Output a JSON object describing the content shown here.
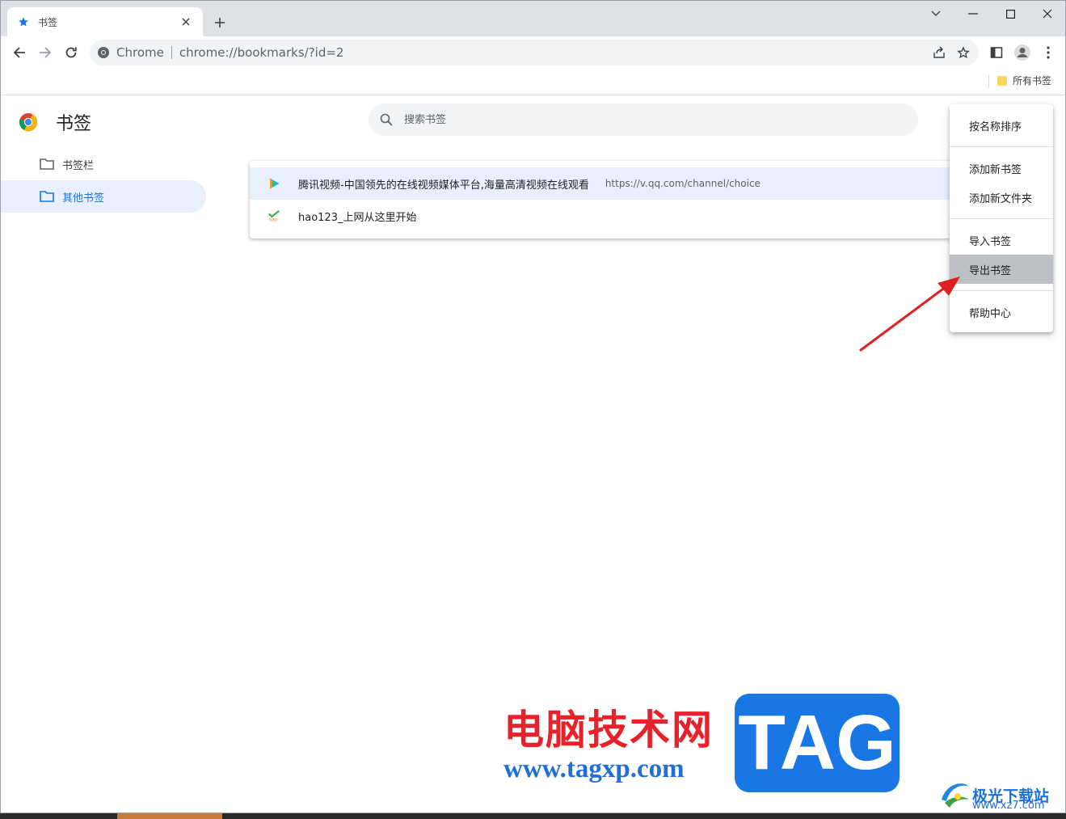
{
  "tab": {
    "title": "书签",
    "close": "×"
  },
  "new_tab": "+",
  "window_controls": {
    "dropdown": "chevron-down",
    "minimize": "minimize",
    "maximize": "maximize",
    "close": "close"
  },
  "omnibox": {
    "chip": "Chrome",
    "url": "chrome://bookmarks/?id=2"
  },
  "bookmarks_bar": {
    "folder_label": "所有书签"
  },
  "page": {
    "title": "书签",
    "search_placeholder": "搜索书签",
    "sidebar": [
      {
        "label": "书签栏",
        "active": false
      },
      {
        "label": "其他书签",
        "active": true
      }
    ],
    "bookmarks": [
      {
        "title": "腾讯视频-中国领先的在线视频媒体平台,海量高清视频在线观看",
        "url": "https://v.qq.com/channel/choice"
      },
      {
        "title": "hao123_上网从这里开始",
        "url": ""
      }
    ]
  },
  "menu": {
    "sort": "按名称排序",
    "add_bookmark": "添加新书签",
    "add_folder": "添加新文件夹",
    "import": "导入书签",
    "export": "导出书签",
    "help": "帮助中心",
    "highlighted": "导出书签"
  },
  "watermark": {
    "cn": "电脑技术网",
    "url": "www.tagxp.com",
    "tag": "TAG",
    "site_cn": "极光下载站",
    "site_en": "www.xz7.com"
  },
  "colors": {
    "accent": "#1a73e8",
    "arrow": "#e02020",
    "watermark_red": "#e8222a",
    "watermark_blue": "#1877e5"
  }
}
